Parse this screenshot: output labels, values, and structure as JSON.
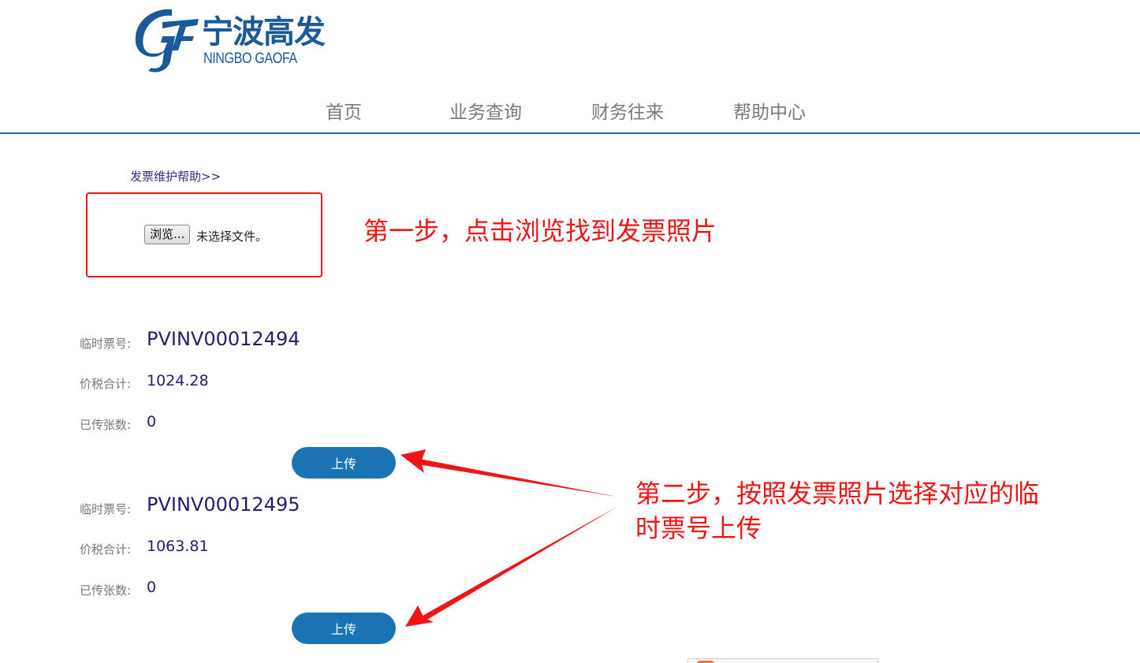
{
  "logo": {
    "cn": "宁波高发",
    "en": "NINGBO GAOFA",
    "brand_color": "#1a5a9a"
  },
  "nav": {
    "items": [
      "首页",
      "业务查询",
      "财务往来",
      "帮助中心"
    ]
  },
  "help_link": "发票维护帮助>>",
  "file_input": {
    "button_label": "浏览...",
    "status": "未选择文件。"
  },
  "annotations": {
    "step1": "第一步，点击浏览找到发票照片",
    "step2": "第二步，按照发票照片选择对应的临时票号上传",
    "color": "#f01414"
  },
  "invoices": [
    {
      "ticket_label": "临时票号:",
      "ticket_no": "PVINV00012494",
      "total_label": "价税合计:",
      "total": "1024.28",
      "count_label": "已传张数:",
      "count": "0",
      "upload_label": "上传"
    },
    {
      "ticket_label": "临时票号:",
      "ticket_no": "PVINV00012495",
      "total_label": "价税合计:",
      "total": "1063.81",
      "count_label": "已传张数:",
      "count": "0",
      "upload_label": "上传"
    }
  ],
  "colors": {
    "accent": "#1a74b4",
    "nav_border": "#2a6f8e",
    "value_text": "#2a1a6e"
  }
}
